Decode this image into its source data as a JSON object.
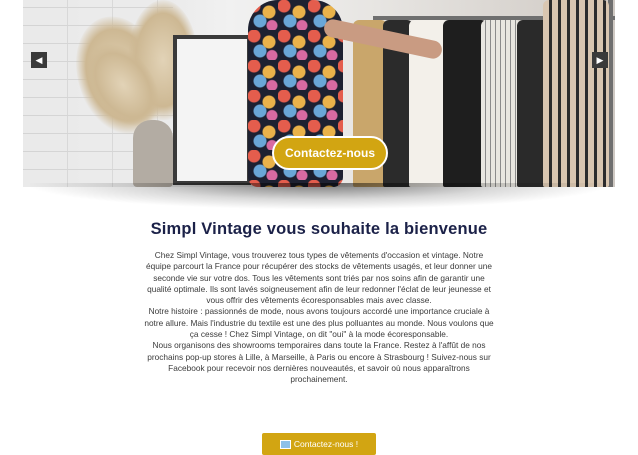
{
  "hero": {
    "button_label": "Contactez-nous",
    "prev_icon": "◀",
    "next_icon": "▶"
  },
  "welcome": {
    "title": "Simpl Vintage vous souhaite la bienvenue",
    "paragraphs": [
      "Chez Simpl Vintage, vous trouverez tous types de vêtements d'occasion et vintage. Notre équipe parcourt la France pour récupérer des stocks de vêtements usagés, et leur donner une seconde vie sur votre dos. Tous les vêtements sont triés par nos soins afin de garantir une qualité optimale. Ils sont lavés soigneusement afin de leur redonner l'éclat de leur jeunesse et vous offrir des vêtements écoresponsables mais avec classe.",
      "Notre histoire : passionnés de mode, nous avons toujours accordé une importance cruciale à notre allure. Mais l'industrie du textile est une des plus polluantes au monde. Nous voulons que ça cesse ! Chez Simpl Vintage, on dit \"oui\" à la mode écoresponsable.",
      "Nous organisons des showrooms temporaires dans toute la France. Restez à l'affût de nos prochains pop-up stores à Lille, à Marseille, à Paris ou encore à Strasbourg ! Suivez-nous sur Facebook pour recevoir nos dernières nouveautés, et savoir où nous apparaîtrons prochainement."
    ]
  },
  "cta": {
    "label": "Contactez-nous !"
  }
}
